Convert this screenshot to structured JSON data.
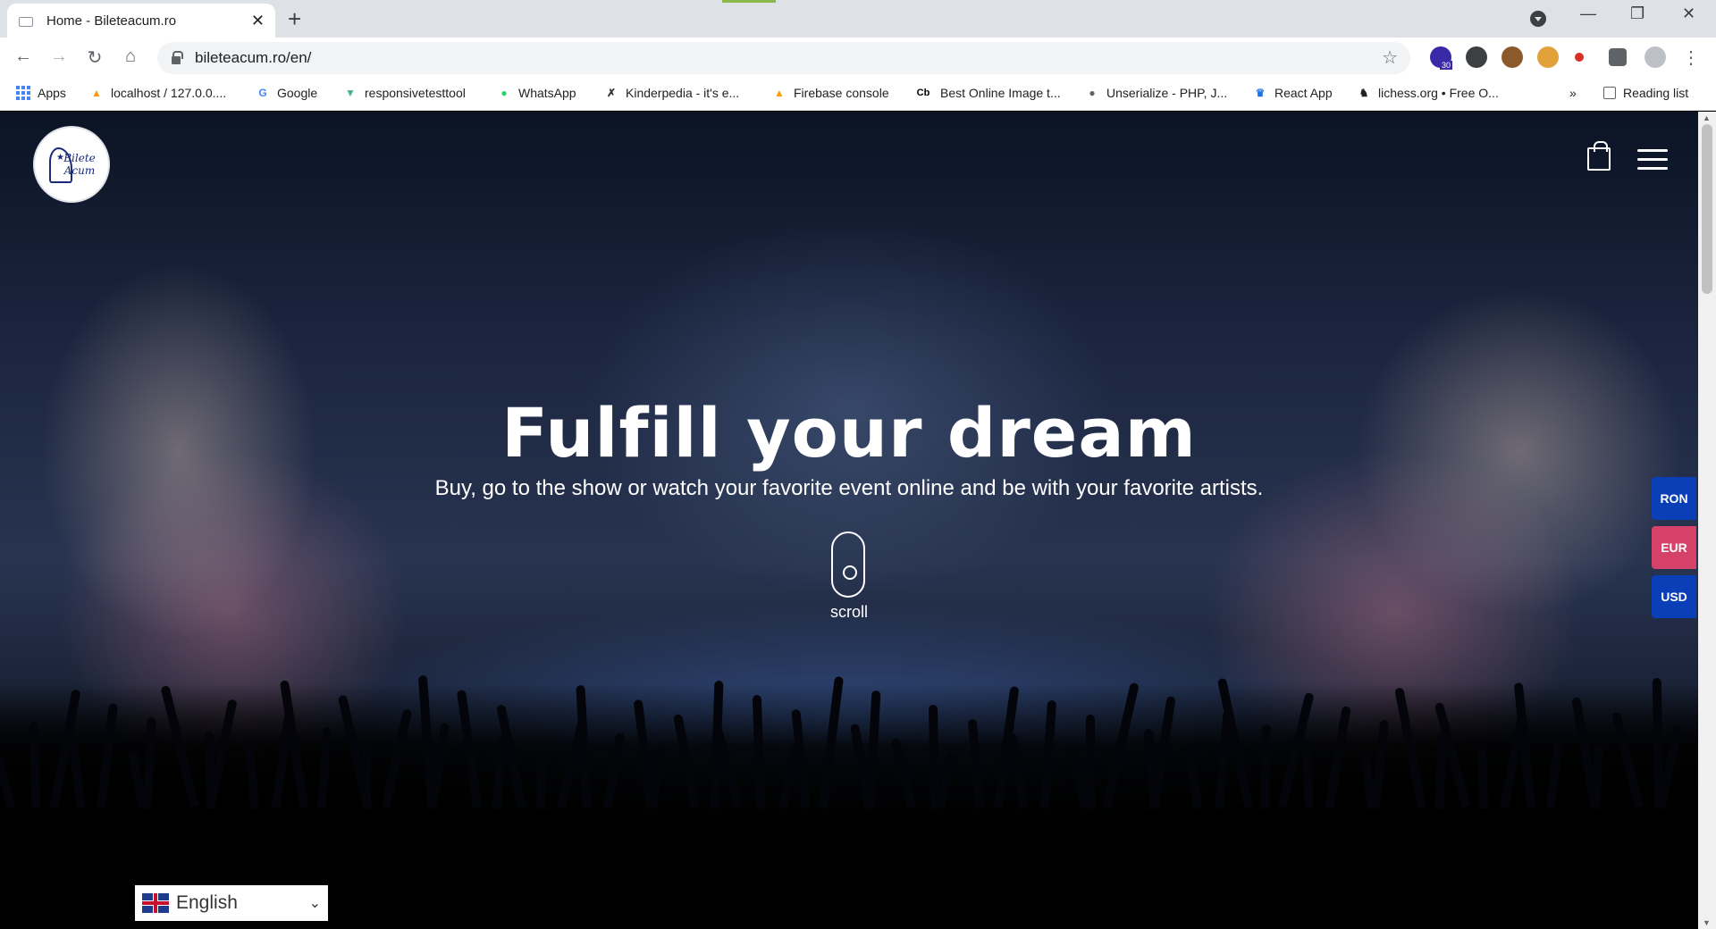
{
  "browser": {
    "tab_title": "Home - Bileteacum.ro",
    "tab_close": "✕",
    "new_tab": "+",
    "win_minimize": "—",
    "win_restore": "❐",
    "win_close": "✕",
    "url": "bileteacum.ro/en/",
    "star": "☆",
    "back": "←",
    "forward": "→",
    "reload": "↻",
    "home": "⌂",
    "ext_badge": "30",
    "more": "⋮"
  },
  "bookmarks": [
    {
      "label": "Apps",
      "icon": "apps-grid-icon"
    },
    {
      "label": "localhost / 127.0.0....",
      "icon": "phpmyadmin-icon"
    },
    {
      "label": "Google",
      "icon": "google-icon",
      "glyph": "G",
      "color": "#4285f4"
    },
    {
      "label": "responsivetesttool",
      "icon": "vue-icon",
      "glyph": "▼",
      "color": "#41b883"
    },
    {
      "label": "WhatsApp",
      "icon": "whatsapp-icon",
      "glyph": "●",
      "color": "#25d366"
    },
    {
      "label": "Kinderpedia - it's e...",
      "icon": "kinderpedia-icon",
      "glyph": "✗",
      "color": "#333333"
    },
    {
      "label": "Firebase console",
      "icon": "firebase-icon",
      "glyph": "▲",
      "color": "#ffa000"
    },
    {
      "label": "Best Online Image t...",
      "icon": "cb-icon",
      "glyph": "Cb",
      "color": "#000000"
    },
    {
      "label": "Unserialize - PHP, J...",
      "icon": "globe-icon",
      "glyph": "●",
      "color": "#5f6368"
    },
    {
      "label": "React App",
      "icon": "react-icon",
      "glyph": "♛",
      "color": "#1a73e8"
    },
    {
      "label": "lichess.org • Free O...",
      "icon": "lichess-icon",
      "glyph": "♞",
      "color": "#202124"
    }
  ],
  "bookmarks_overflow": "»",
  "reading_list": "Reading list",
  "site": {
    "logo_line1": "Bilete",
    "logo_line2": "Acum",
    "headline": "Fulfill your dream",
    "subline": "Buy, go to the show or watch your favorite event online and be with your favorite artists.",
    "scroll_label": "scroll",
    "currencies": [
      {
        "label": "RON",
        "color": "#0a3fb8"
      },
      {
        "label": "EUR",
        "color": "#d6416a"
      },
      {
        "label": "USD",
        "color": "#0a3fb8"
      }
    ],
    "language": "English",
    "language_caret": "⌄"
  }
}
